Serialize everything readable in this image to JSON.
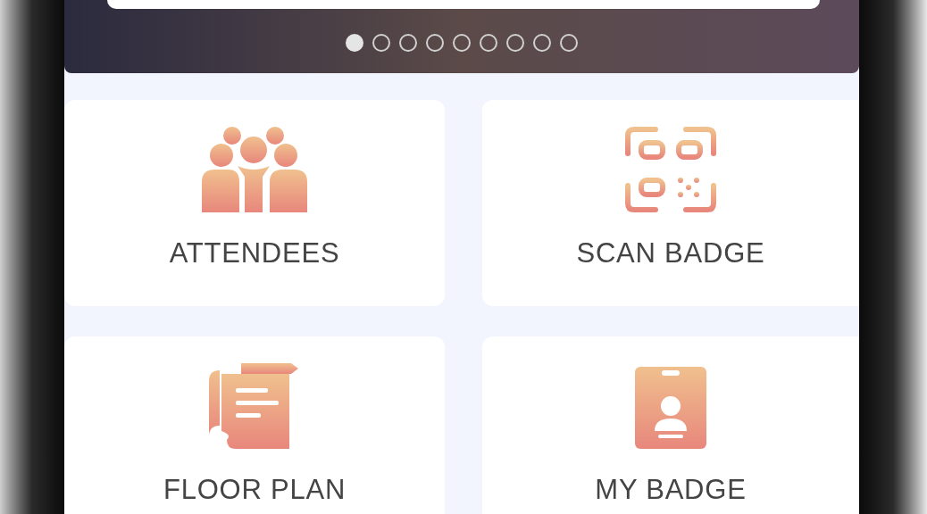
{
  "carousel": {
    "dots": [
      {
        "selected": true
      },
      {
        "selected": false
      },
      {
        "selected": false
      },
      {
        "selected": false
      },
      {
        "selected": false
      },
      {
        "selected": false
      },
      {
        "selected": false
      },
      {
        "selected": false
      },
      {
        "selected": false
      }
    ]
  },
  "tiles": [
    {
      "kind": "people",
      "label": "ATTENDEES"
    },
    {
      "kind": "qr",
      "label": "SCAN BADGE"
    },
    {
      "kind": "map",
      "label": "FLOOR PLAN"
    },
    {
      "kind": "badge",
      "label": "MY BADGE"
    }
  ]
}
